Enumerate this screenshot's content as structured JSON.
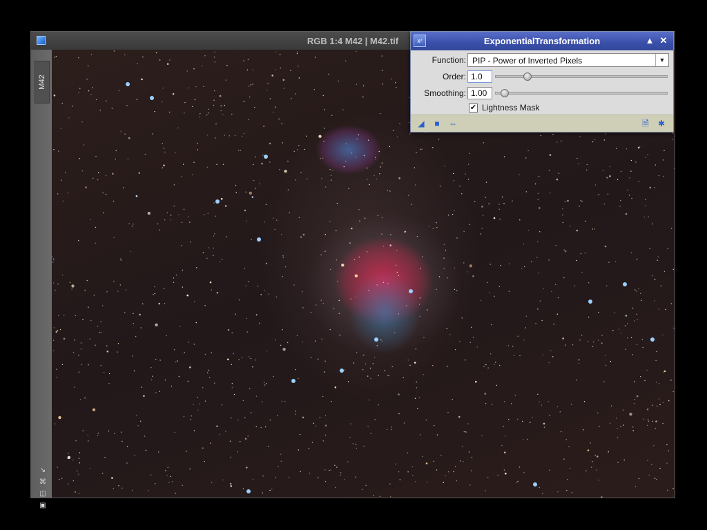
{
  "image_window": {
    "title": "RGB 1:4 M42 | M42.tif",
    "view_tab": "M42",
    "icons": [
      "fit-view-icon",
      "zoom-to-fit-icon",
      "zoom-out-icon",
      "zoom-box-icon"
    ]
  },
  "process_dialog": {
    "title": "ExponentialTransformation",
    "function_label": "Function:",
    "function_value": "PIP - Power of Inverted Pixels",
    "order_label": "Order:",
    "order_value": "1.0",
    "order_level": 0.17,
    "smoothing_label": "Smoothing:",
    "smoothing_value": "1.00",
    "smoothing_level": 0.03,
    "lightness_mask_label": "Lightness Mask",
    "lightness_mask_checked": true,
    "footer_icons_left": [
      "new-instance-icon",
      "apply-global-icon",
      "preview-icon"
    ],
    "footer_icons_right": [
      "reset-icon",
      "close-icon"
    ]
  },
  "colors": {
    "dialog_titlebar": "#3a4fa8",
    "nebula_red": "#d22850",
    "nebula_blue": "#3c8cc8"
  }
}
